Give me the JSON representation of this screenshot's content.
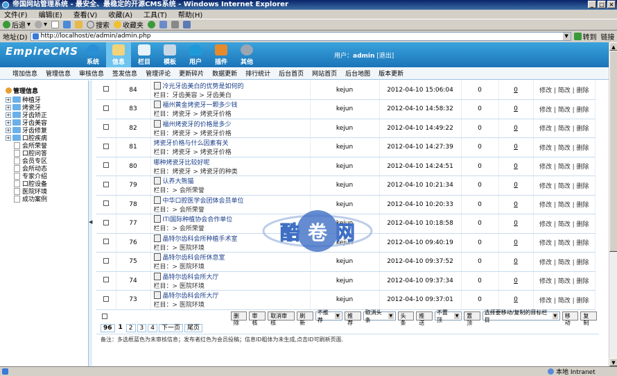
{
  "window": {
    "title": "帝国网站管理系统 - 最安全、最稳定的开源CMS系统 - Windows Internet Explorer"
  },
  "menu": [
    "文件(F)",
    "编辑(E)",
    "查看(V)",
    "收藏(A)",
    "工具(T)",
    "帮助(H)"
  ],
  "toolbar": {
    "back": "后退",
    "search": "搜索",
    "favorites": "收藏夹"
  },
  "address": {
    "label": "地址(D)",
    "url": "http://localhost/e/admin/admin.php",
    "go": "转到",
    "links": "链接"
  },
  "cms": {
    "logo": "EmpireCMS",
    "nav": [
      {
        "label": "系统",
        "color": "#2a8fd6"
      },
      {
        "label": "信息",
        "color": "#f3d37a"
      },
      {
        "label": "栏目",
        "color": "#e8f2fb"
      },
      {
        "label": "模板",
        "color": "#c9d8e6"
      },
      {
        "label": "用户",
        "color": "#1f9ad8"
      },
      {
        "label": "插件",
        "color": "#e68a2e"
      },
      {
        "label": "其他",
        "color": "#9aa6b4"
      }
    ],
    "user_label": "用户：",
    "user_name": "admin",
    "logout": "[退出]"
  },
  "subnav": [
    "增加信息",
    "管理信息",
    "审核信息",
    "签发信息",
    "管理评论",
    "更新碎片",
    "数据更新",
    "排行统计",
    "后台首页",
    "网站首页",
    "后台地图",
    "版本更新"
  ],
  "sidebar": {
    "root": "管理信息",
    "nodes": [
      "种植牙",
      "烤瓷牙",
      "牙齿矫正",
      "牙齿美容",
      "牙齿修复",
      "口腔疾病"
    ],
    "leaves": [
      "会所荣誉",
      "口腔问答",
      "会员专区",
      "会所动态",
      "专家介绍",
      "口腔设备",
      "医院环境",
      "成功案例"
    ]
  },
  "table": {
    "rows": [
      {
        "id": "84",
        "title": "冷光牙齿美白的优势是如何的",
        "cat": "栏目：牙齿美容 > 牙齿美白",
        "user": "kejun",
        "time": "2012-04-10 15:06:04",
        "clicks": "0",
        "comments": "0",
        "icon": true
      },
      {
        "id": "83",
        "title": "福州黄金烤瓷牙一颗多少钱",
        "cat": "栏目：烤瓷牙 > 烤瓷牙价格",
        "user": "kejun",
        "time": "2012-04-10 14:58:32",
        "clicks": "0",
        "comments": "0",
        "icon": true
      },
      {
        "id": "82",
        "title": "福州烤瓷牙的价格是多少",
        "cat": "栏目：烤瓷牙 > 烤瓷牙价格",
        "user": "kejun",
        "time": "2012-04-10 14:49:22",
        "clicks": "0",
        "comments": "0",
        "icon": true
      },
      {
        "id": "81",
        "title": "烤瓷牙价格与什么因素有关",
        "cat": "栏目：烤瓷牙 > 烤瓷牙价格",
        "user": "kejun",
        "time": "2012-04-10 14:27:39",
        "clicks": "0",
        "comments": "0",
        "icon": false
      },
      {
        "id": "80",
        "title": "哪种烤瓷牙比较好呢",
        "cat": "栏目：烤瓷牙 > 烤瓷牙的种类",
        "user": "kejun",
        "time": "2012-04-10 14:24:51",
        "clicks": "0",
        "comments": "0",
        "icon": false
      },
      {
        "id": "79",
        "title": "认养大熊猫",
        "cat": "栏目：> 会所荣誉",
        "user": "kejun",
        "time": "2012-04-10 10:21:34",
        "clicks": "0",
        "comments": "0",
        "icon": true
      },
      {
        "id": "78",
        "title": "中华口腔医学会团体会员单位",
        "cat": "栏目：> 会所荣誉",
        "user": "kejun",
        "time": "2012-04-10 10:20:33",
        "clicks": "0",
        "comments": "0",
        "icon": true
      },
      {
        "id": "77",
        "title": "ITI国际种植协会合作单位",
        "cat": "栏目：> 会所荣誉",
        "user": "kejun",
        "time": "2012-04-10 10:18:58",
        "clicks": "0",
        "comments": "0",
        "icon": true
      },
      {
        "id": "76",
        "title": "晶特尔齿科会所种植手术室",
        "cat": "栏目：> 医院环境",
        "user": "kejun",
        "time": "2012-04-10 09:40:19",
        "clicks": "0",
        "comments": "0",
        "icon": true
      },
      {
        "id": "75",
        "title": "晶特尔齿科会所休息室",
        "cat": "栏目：> 医院环境",
        "user": "kejun",
        "time": "2012-04-10 09:37:52",
        "clicks": "0",
        "comments": "0",
        "icon": true
      },
      {
        "id": "74",
        "title": "晶特尔齿科会所大厅",
        "cat": "栏目：> 医院环境",
        "user": "kejun",
        "time": "2012-04-10 09:37:34",
        "clicks": "0",
        "comments": "0",
        "icon": true
      },
      {
        "id": "73",
        "title": "晶特尔齿科会所大厅",
        "cat": "栏目：> 医院环境",
        "user": "kejun",
        "time": "2012-04-10 09:37:01",
        "clicks": "0",
        "comments": "0",
        "icon": true
      }
    ],
    "ops": {
      "modify": "修改",
      "simple_modify": "简改",
      "delete": "删除"
    }
  },
  "actions": {
    "delete": "删除",
    "audit": "审核",
    "cancel_audit": "取消审核",
    "refresh": "刷新",
    "recommend_select": "不推荐",
    "recommend": "推荐",
    "head_select": "取消头条",
    "head": "头条",
    "push": "推送",
    "top_select": "不置顶",
    "top": "置顶",
    "target_select": "选择要移动/复制的目标栏目",
    "move": "移动",
    "copy": "复制"
  },
  "pager": {
    "total": "96",
    "pages": [
      "1",
      "2",
      "3",
      "4"
    ],
    "next": "下一页",
    "last": "尾页"
  },
  "note": "备注：多选框蓝色为未审核信息；发布者红色为会员投稿；信息ID粗体为未生成,点击ID可刷新页面.",
  "status": {
    "zone": "本地 Intranet"
  },
  "watermark": {
    "text": [
      "酷",
      "卷",
      "网"
    ]
  }
}
